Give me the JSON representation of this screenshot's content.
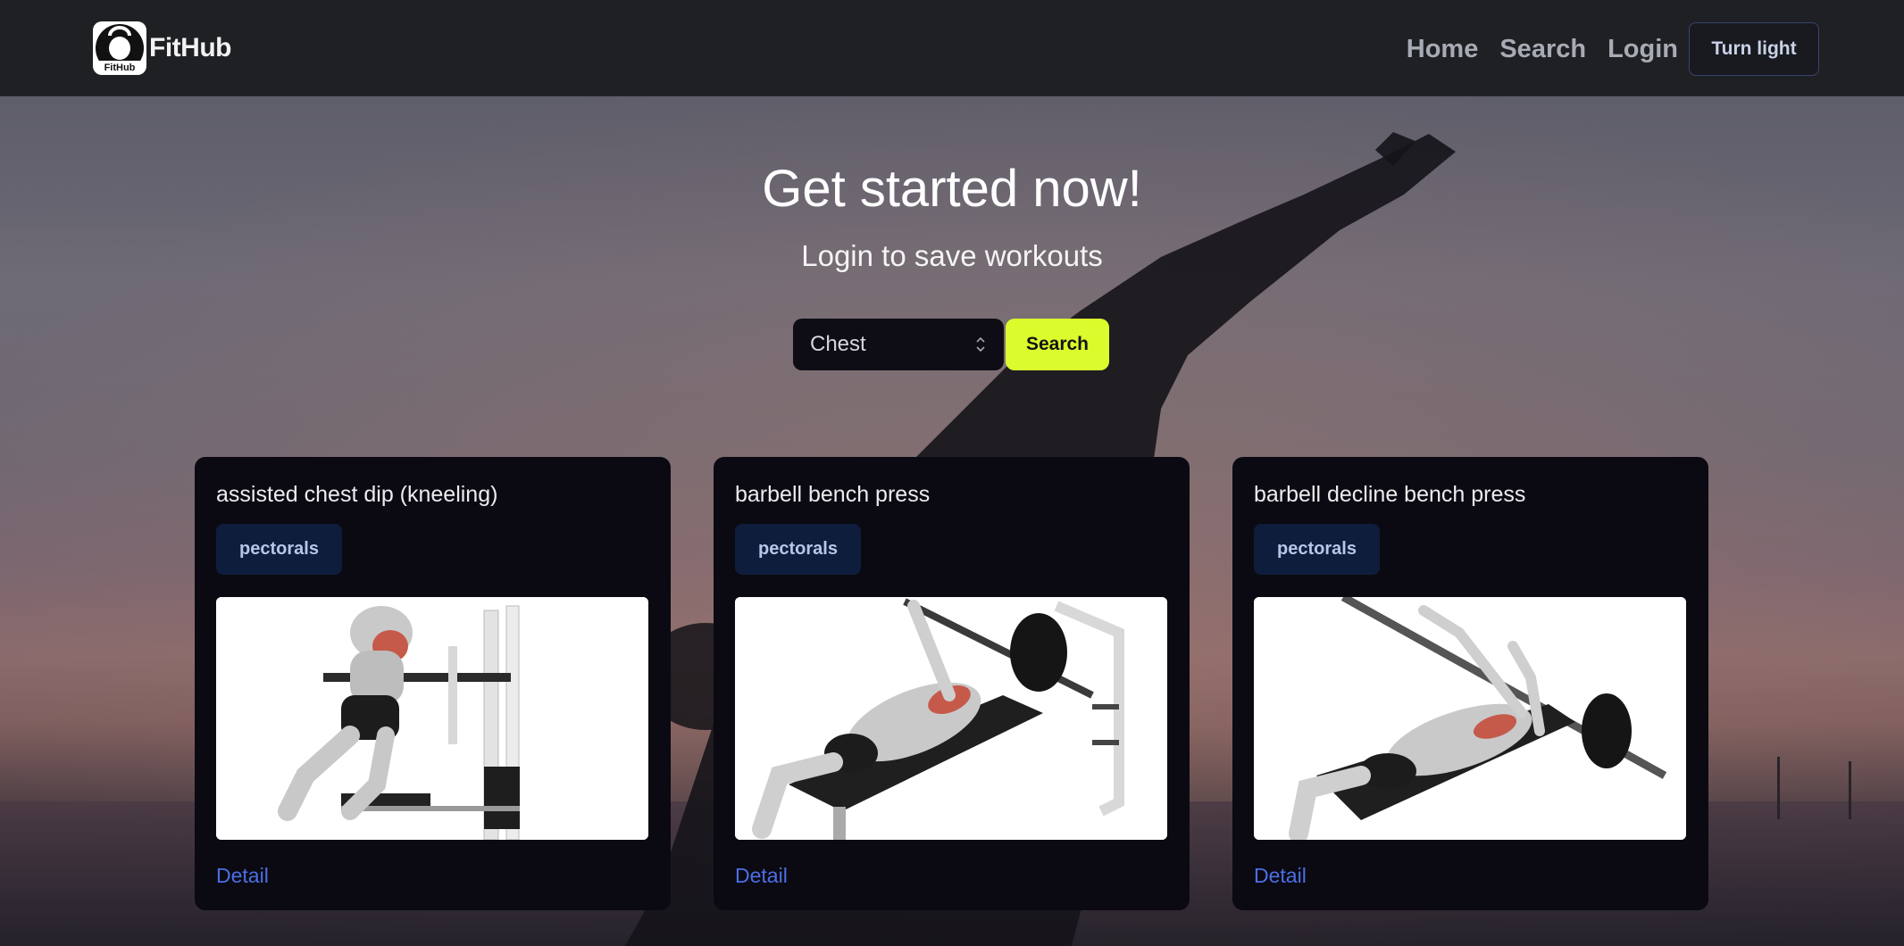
{
  "navbar": {
    "logo_text": "FitHub",
    "brand": "FitHub",
    "links": [
      "Home",
      "Search",
      "Login"
    ],
    "theme_button": "Turn light"
  },
  "hero": {
    "title": "Get started now!",
    "subtitle": "Login to save workouts",
    "search": {
      "selected_body_part": "Chest",
      "button_label": "Search"
    }
  },
  "colors": {
    "accent": "#dcfb2c",
    "link": "#4c6ee6",
    "badge_bg": "#0f1d3c",
    "card_bg": "#0b0a12"
  },
  "exercises": [
    {
      "name": "assisted chest dip (kneeling)",
      "target": "pectorals",
      "detail_label": "Detail",
      "image": "assisted-chest-dip-illustration"
    },
    {
      "name": "barbell bench press",
      "target": "pectorals",
      "detail_label": "Detail",
      "image": "barbell-bench-press-illustration"
    },
    {
      "name": "barbell decline bench press",
      "target": "pectorals",
      "detail_label": "Detail",
      "image": "barbell-decline-bench-press-illustration"
    }
  ]
}
